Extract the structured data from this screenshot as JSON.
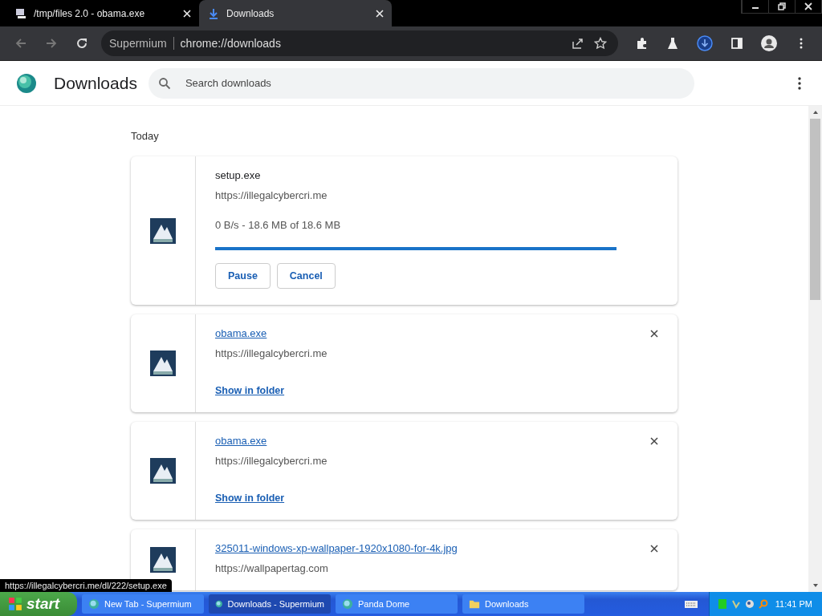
{
  "browser_tabs": [
    {
      "title": "/tmp/files 2.0 - obama.exe",
      "selected": false
    },
    {
      "title": "Downloads",
      "selected": true
    }
  ],
  "address_bar": {
    "site": "Supermium",
    "url": "chrome://downloads"
  },
  "page_header": {
    "title": "Downloads",
    "search": {
      "placeholder": "Search downloads"
    }
  },
  "section_heading": "Today",
  "downloads": [
    {
      "kind": "in-progress",
      "file_name": "setup.exe",
      "source": "https://illegalcybercri.me",
      "progress_text": "0 B/s - 18.6 MB of 18.6 MB",
      "level": 1,
      "buttons": [
        "Pause",
        "Cancel"
      ]
    },
    {
      "kind": "complete",
      "file_name": "obama.exe",
      "source": "https://illegalcybercri.me",
      "action": "Show in folder"
    },
    {
      "kind": "complete",
      "file_name": "obama.exe",
      "source": "https://illegalcybercri.me",
      "action": "Show in folder"
    },
    {
      "kind": "complete",
      "file_name": "325011-windows-xp-wallpaper-1920x1080-for-4k.jpg",
      "source": "https://wallpapertag.com"
    }
  ],
  "status_link": "https://illegalcybercri.me/dl/222/setup.exe",
  "taskbar": {
    "start": "start",
    "items": [
      {
        "label": "New Tab - Supermium",
        "selected": false
      },
      {
        "label": "Downloads - Supermium",
        "selected": true
      },
      {
        "label": "Panda Dome",
        "selected": false
      },
      {
        "label": "Downloads",
        "selected": false
      }
    ],
    "clock": "11:41 PM"
  }
}
